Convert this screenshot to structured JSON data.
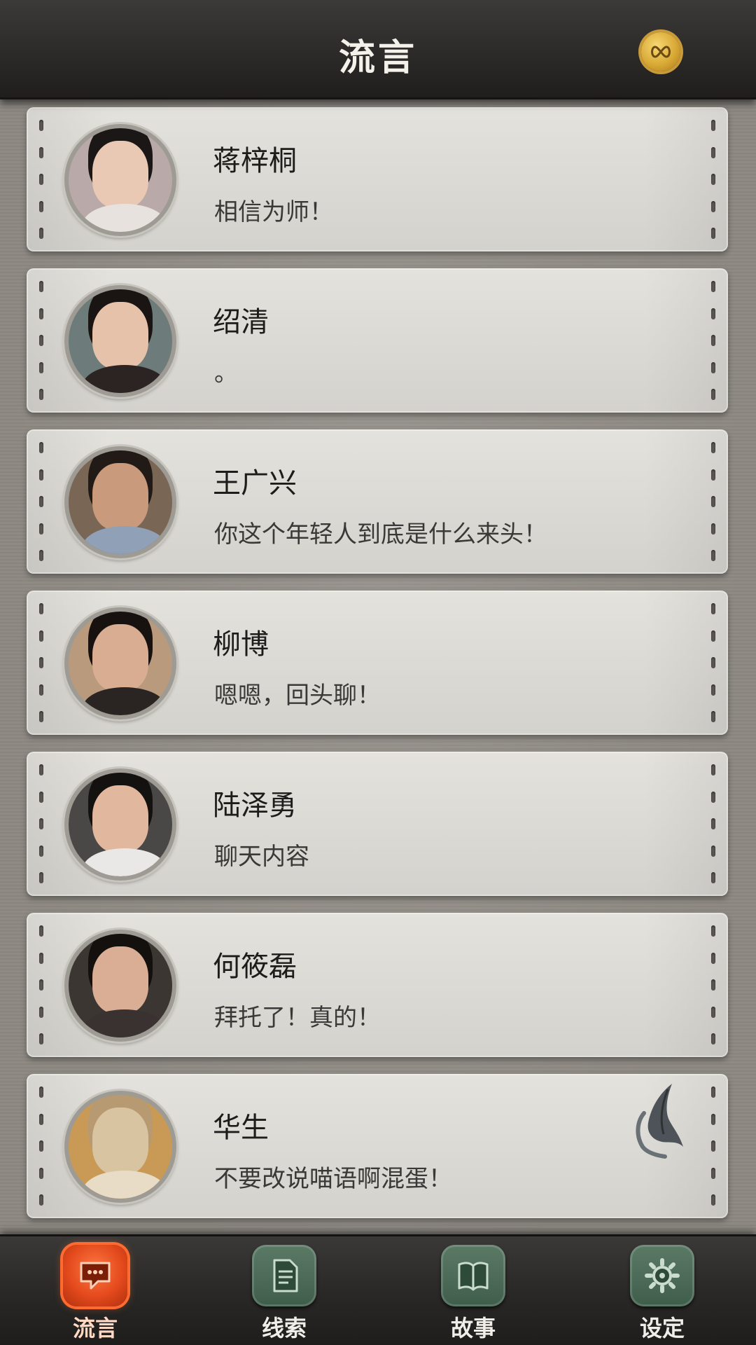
{
  "header": {
    "title": "流言",
    "currency_icon": "infinity-coin-icon"
  },
  "contacts": [
    {
      "name": "蒋梓桐",
      "message": "相信为师！",
      "avatar": {
        "skin": "#e9c9b4",
        "hair": "#1b1716",
        "bg": "#b9a9a8",
        "shirt": "#e7e2de"
      }
    },
    {
      "name": "绍清",
      "message": "。",
      "avatar": {
        "skin": "#e6c2ab",
        "hair": "#1a1512",
        "bg": "#6d7b7a",
        "shirt": "#2b2422"
      }
    },
    {
      "name": "王广兴",
      "message": "你这个年轻人到底是什么来头！",
      "avatar": {
        "skin": "#c99a7c",
        "hair": "#211a17",
        "bg": "#7a6654",
        "shirt": "#8fa0b7"
      }
    },
    {
      "name": "柳博",
      "message": "嗯嗯，回头聊！",
      "avatar": {
        "skin": "#d8ad92",
        "hair": "#17120f",
        "bg": "#b99a7c",
        "shirt": "#2a2522"
      }
    },
    {
      "name": "陆泽勇",
      "message": "聊天内容",
      "avatar": {
        "skin": "#e1b89e",
        "hair": "#141111",
        "bg": "#4a4846",
        "shirt": "#e9e8e6"
      }
    },
    {
      "name": "何筱磊",
      "message": "拜托了！真的！",
      "avatar": {
        "skin": "#d9ae95",
        "hair": "#14100e",
        "bg": "#3b3632",
        "shirt": "#3a3230"
      }
    },
    {
      "name": "华生",
      "message": "不要改说喵语啊混蛋！",
      "avatar": {
        "skin": "#d9c4a2",
        "hair": "#b89a72",
        "bg": "#c89a55",
        "shirt": "#e8dcc6"
      },
      "badge_icon": "quill-feather-icon"
    }
  ],
  "tabs": [
    {
      "label": "流言",
      "icon": "chat-bubble-icon",
      "active": true
    },
    {
      "label": "线索",
      "icon": "document-icon",
      "active": false
    },
    {
      "label": "故事",
      "icon": "book-icon",
      "active": false
    },
    {
      "label": "设定",
      "icon": "gear-icon",
      "active": false
    }
  ],
  "colors": {
    "active_tab": "#e44a1d",
    "inactive_tab": "#4f6e5a",
    "card_paper": "#dcdad5",
    "header_bg": "#2a2928"
  }
}
